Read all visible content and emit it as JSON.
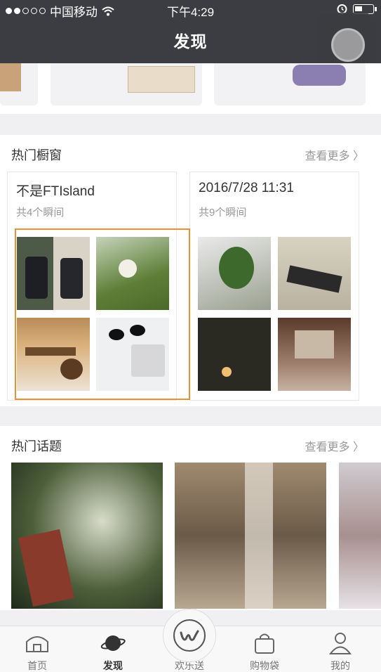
{
  "status": {
    "carrier": "中国移动",
    "time": "下午4:29"
  },
  "header": {
    "title": "发现"
  },
  "hot_window": {
    "title": "热门橱窗",
    "more": "查看更多",
    "cards": [
      {
        "title": "不是FTIsland",
        "subtitle": "共4个瞬间"
      },
      {
        "title": "2016/7/28 11:31",
        "subtitle": "共9个瞬间"
      }
    ]
  },
  "hot_topics": {
    "title": "热门话题",
    "more": "查看更多"
  },
  "tabbar": {
    "items": [
      {
        "label": "首页"
      },
      {
        "label": "发现"
      },
      {
        "label": "欢乐送"
      },
      {
        "label": "购物袋"
      },
      {
        "label": "我的"
      }
    ]
  }
}
